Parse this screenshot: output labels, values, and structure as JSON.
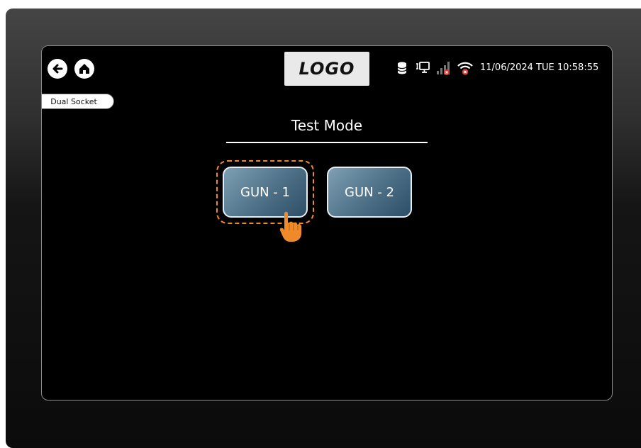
{
  "header": {
    "logo_text": "LOGO",
    "datetime": "11/06/2024 TUE 10:58:55",
    "icons": [
      "back-icon",
      "home-icon",
      "database-icon",
      "network-icon",
      "signal-icon",
      "wifi-icon"
    ]
  },
  "mode_tag": "Dual Socket",
  "page": {
    "title": "Test Mode"
  },
  "guns": [
    {
      "label": "GUN - 1",
      "highlighted": true
    },
    {
      "label": "GUN - 2",
      "highlighted": false
    }
  ],
  "colors": {
    "screen_bg": "#000000",
    "button_gradient_start": "#7e9fb3",
    "button_gradient_end": "#2e4f66",
    "highlight": "#ef8a2a",
    "error_red": "#e53935"
  }
}
